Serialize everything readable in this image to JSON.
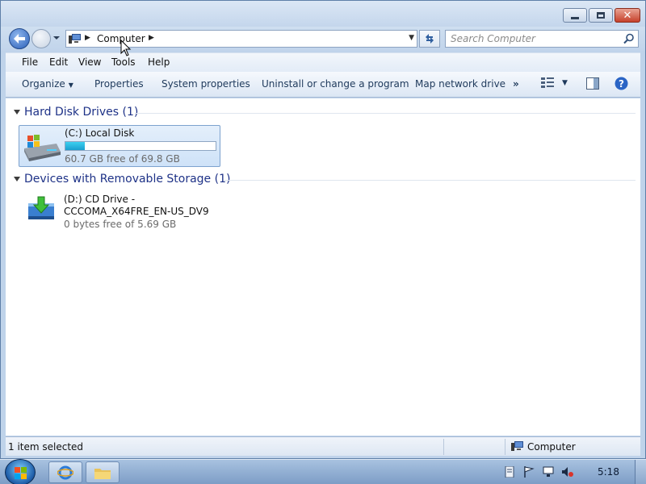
{
  "window": {
    "caption_buttons": [
      "minimize-icon",
      "maximize-icon",
      "close-icon"
    ]
  },
  "navigation": {
    "address": {
      "crumbs": [
        "Computer"
      ]
    },
    "search": {
      "placeholder": "Search Computer"
    }
  },
  "menubar": {
    "items": [
      "File",
      "Edit",
      "View",
      "Tools",
      "Help"
    ]
  },
  "toolbar": {
    "organize": "Organize",
    "properties": "Properties",
    "system_properties": "System properties",
    "uninstall": "Uninstall or change a program",
    "map_drive": "Map network drive",
    "more": "»"
  },
  "groups": {
    "hard_disks": {
      "label": "Hard Disk Drives (1)",
      "drives": [
        {
          "name": "(C:) Local Disk",
          "free_text": "60.7 GB free of 69.8 GB",
          "used_fraction": 0.13
        }
      ]
    },
    "removable": {
      "label": "Devices with Removable Storage (1)",
      "devices": [
        {
          "name_line1": "(D:) CD Drive -",
          "name_line2": "CCCOMA_X64FRE_EN-US_DV9",
          "free_text": "0 bytes free of 5.69 GB"
        }
      ]
    }
  },
  "statusbar": {
    "selection": "1 item selected",
    "location": "Computer"
  },
  "taskbar": {
    "clock": "5:18"
  },
  "colors": {
    "accent": "#1e3287",
    "selection": "#cee2f8",
    "drive_fill": "#26b4e0"
  }
}
